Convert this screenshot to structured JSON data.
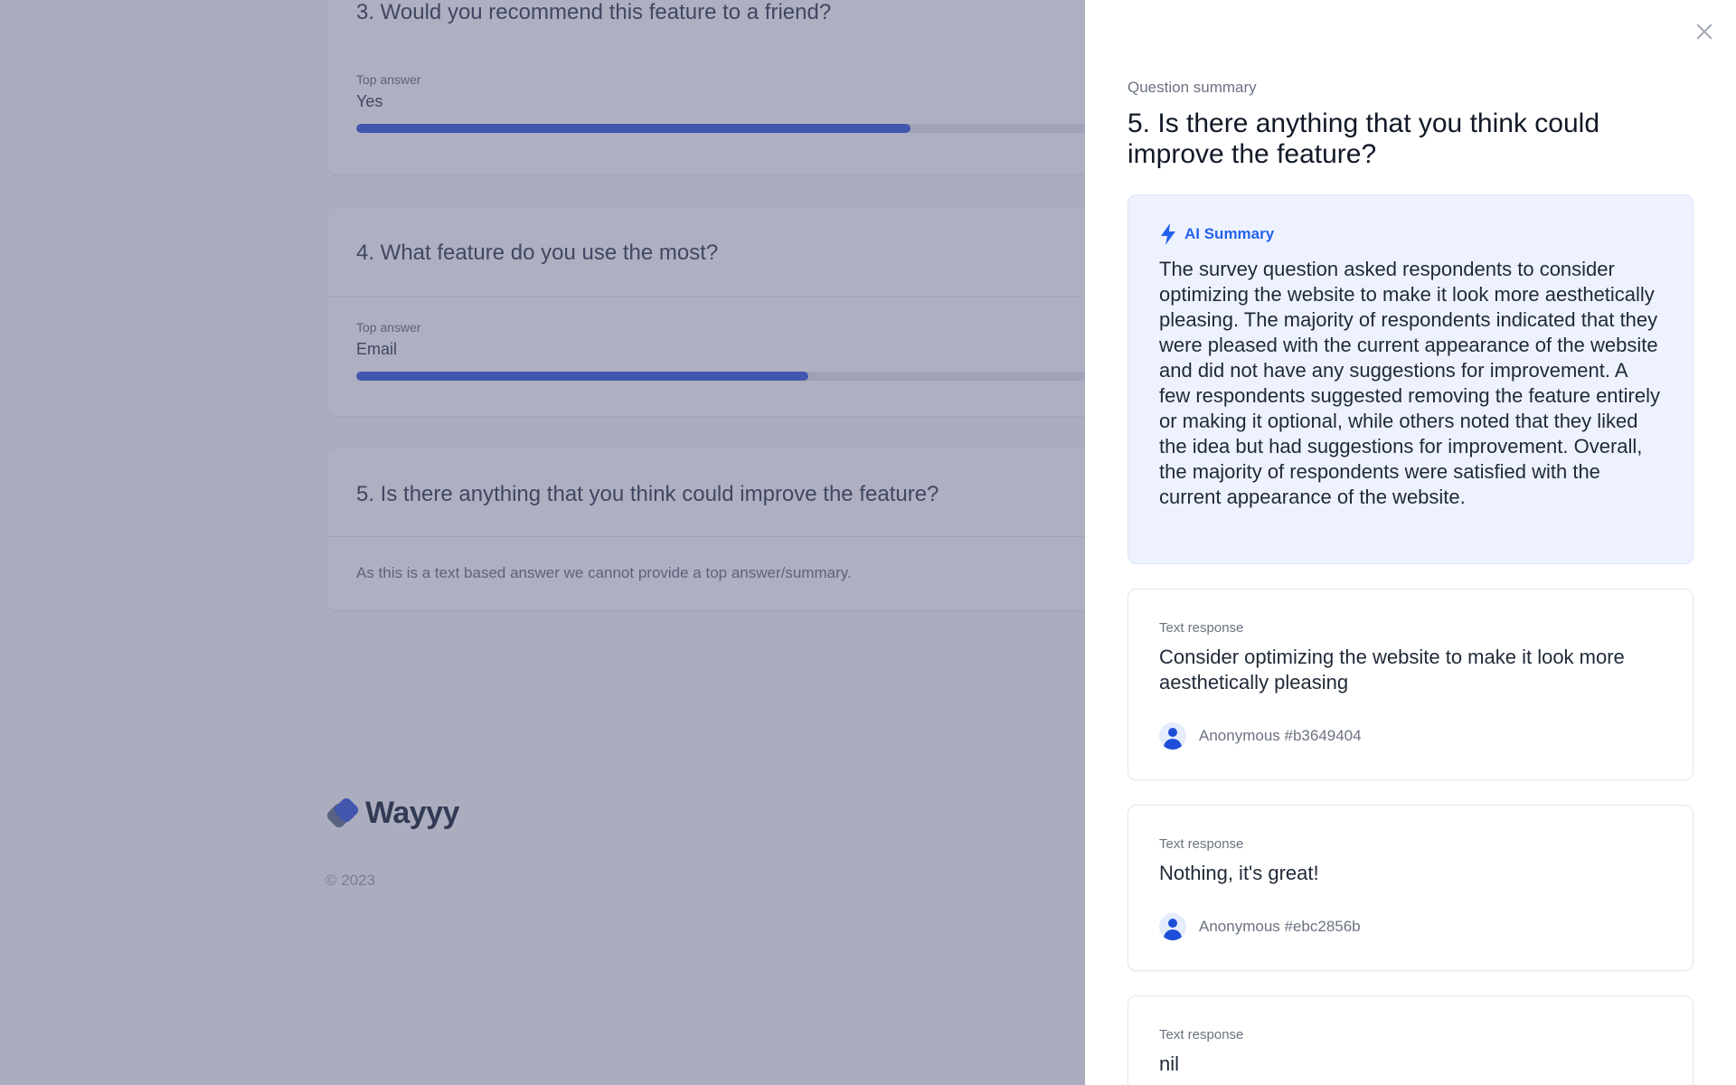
{
  "background": {
    "questions": [
      {
        "title": "3. Would you recommend this feature to a friend?",
        "top_label": "Top answer",
        "top_value": "Yes",
        "share": 0.54
      },
      {
        "title": "4. What feature do you use the most?",
        "top_label": "Top answer",
        "top_value": "Email",
        "share": 0.44
      },
      {
        "title": "5. Is there anything that you think could improve the feature?",
        "note": "As this is a text based answer we cannot provide a top answer/summary."
      }
    ],
    "logo": "Wayyy",
    "copyright": "© 2023"
  },
  "panel": {
    "eyebrow": "Question summary",
    "title": "5. Is there anything that you think could improve the feature?",
    "ai_summary": {
      "label": "AI Summary",
      "text": "The survey question asked respondents to consider optimizing the website to make it look more aesthetically pleasing. The majority of respondents indicated that they were pleased with the current appearance of the website and did not have any suggestions for improvement. A few respondents suggested removing the feature entirely or making it optional, while others noted that they liked the idea but had suggestions for improvement. Overall, the majority of respondents were satisfied with the current appearance of the website."
    },
    "responses": [
      {
        "label": "Text response",
        "text": "Consider optimizing the website to make it look more aesthetically pleasing",
        "user": "Anonymous #b3649404"
      },
      {
        "label": "Text response",
        "text": "Nothing, it's great!",
        "user": "Anonymous #ebc2856b"
      },
      {
        "label": "Text response",
        "text": "nil"
      }
    ]
  },
  "colors": {
    "accent": "#2563eb",
    "bar": "#3b5bdb",
    "overlay": "#4b4f75"
  }
}
